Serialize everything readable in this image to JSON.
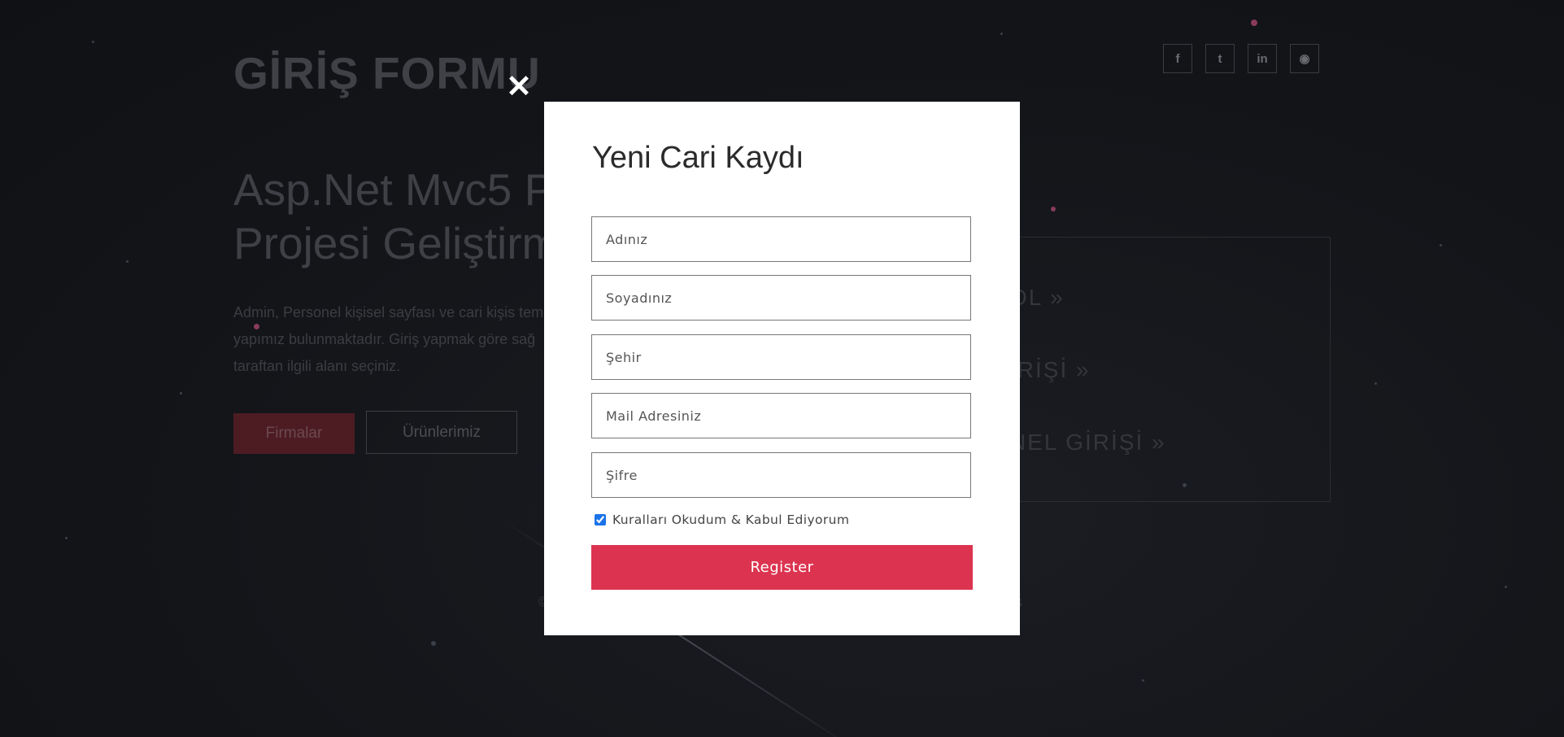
{
  "page": {
    "logo": "GİRİŞ FORMU",
    "hero_title_line1": "Asp.Net Mvc5 P",
    "hero_title_line2": "Projesi Geliştirm",
    "hero_text": "Admin, Personel kişisel sayfası ve cari kişis temel yapımız bulunmaktadır. Giriş yapmak göre sağ taraftan ilgili alanı seçiniz.",
    "buttons": {
      "firmalar": "Firmalar",
      "urunler": "Ürünlerimiz"
    },
    "social": [
      {
        "icon": "facebook-icon",
        "glyph": "f"
      },
      {
        "icon": "twitter-icon",
        "glyph": "t"
      },
      {
        "icon": "linkedin-icon",
        "glyph": "in"
      },
      {
        "icon": "github-icon",
        "glyph": "◉"
      }
    ],
    "side_links": [
      "OL »",
      "İRİŞİ »",
      "NEL GİRİŞİ »"
    ],
    "footer_fragments": [
      "©",
      "s"
    ]
  },
  "modal": {
    "title": "Yeni Cari Kaydı",
    "close_icon": "close-icon",
    "fields": {
      "first_name": {
        "placeholder": "Adınız",
        "value": ""
      },
      "last_name": {
        "placeholder": "Soyadınız",
        "value": ""
      },
      "city": {
        "placeholder": "Şehir",
        "value": ""
      },
      "email": {
        "placeholder": "Mail Adresiniz",
        "value": ""
      },
      "password": {
        "placeholder": "Şifre",
        "value": ""
      }
    },
    "terms_label": "Kuralları Okudum & Kabul Ediyorum",
    "terms_checked": true,
    "register_label": "Register",
    "colors": {
      "register_button": "#dc3450",
      "overlay": "#121419"
    }
  }
}
